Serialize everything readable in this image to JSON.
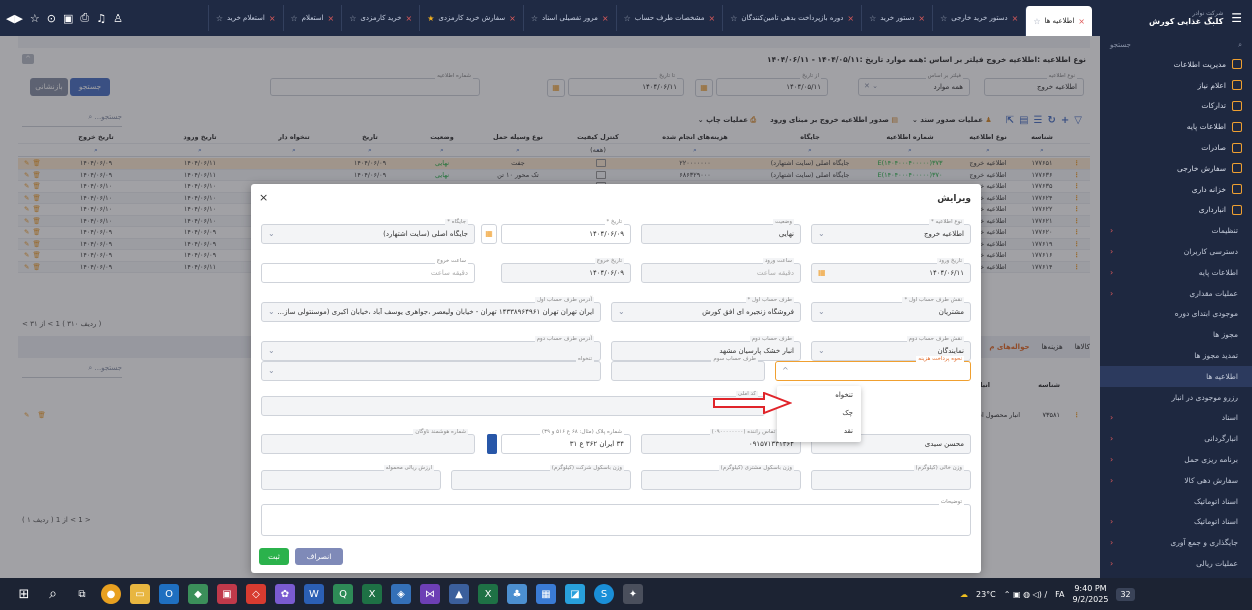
{
  "tabs": {
    "items": [
      {
        "label": "اطلاعیه ها",
        "active": true
      },
      {
        "label": "دستور خرید خارجی"
      },
      {
        "label": "دستور خرید"
      },
      {
        "label": "دوره بازپرداخت بدهی تامین‌کنندگان"
      },
      {
        "label": "مشخصات طرف حساب"
      },
      {
        "label": "مرور تفصیلی اسناد"
      },
      {
        "label": "سفارش خرید کارمزدی",
        "starred": true
      },
      {
        "label": "خرید کارمزدی"
      },
      {
        "label": "استعلام"
      },
      {
        "label": "استعلام خرید"
      }
    ]
  },
  "sidebar": {
    "company_small": "شرکت نوادر",
    "company": "کلبگ غذایی کورش",
    "search_placeholder": "جستجو",
    "items": [
      {
        "label": "مدیریت اطلاعات",
        "sub": false,
        "arrow": false,
        "active": false
      },
      {
        "label": "اعلام نیاز",
        "sub": false,
        "arrow": false,
        "active": false
      },
      {
        "label": "تدارکات",
        "sub": false,
        "arrow": false,
        "active": false
      },
      {
        "label": "اطلاعات پایه",
        "sub": false,
        "arrow": false,
        "active": false
      },
      {
        "label": "صادرات",
        "sub": false,
        "arrow": false,
        "active": false
      },
      {
        "label": "سفارش خارجی",
        "sub": false,
        "arrow": false,
        "active": false
      },
      {
        "label": "خزانه داری",
        "sub": false,
        "arrow": false,
        "active": false
      },
      {
        "label": "انبارداری",
        "sub": false,
        "arrow": false,
        "active": false
      },
      {
        "label": "تنظیمات",
        "sub": true,
        "arrow": true,
        "active": false
      },
      {
        "label": "دسترسی کاربران",
        "sub": true,
        "arrow": true,
        "active": false
      },
      {
        "label": "اطلاعات پایه",
        "sub": true,
        "arrow": true,
        "active": false
      },
      {
        "label": "عملیات مقداری",
        "sub": true,
        "arrow": true,
        "active": false
      },
      {
        "label": "موجودی ابتدای دوره",
        "sub": true,
        "arrow": false,
        "active": false
      },
      {
        "label": "مجوز ها",
        "sub": true,
        "arrow": false,
        "active": false
      },
      {
        "label": "تمدید مجوز ها",
        "sub": true,
        "arrow": false,
        "active": false
      },
      {
        "label": "اطلاعیه ها",
        "sub": true,
        "arrow": false,
        "active": true
      },
      {
        "label": "رزرو موجودی در انبار",
        "sub": true,
        "arrow": false,
        "active": false
      },
      {
        "label": "اسناد",
        "sub": true,
        "arrow": true,
        "active": false
      },
      {
        "label": "انبارگردانی",
        "sub": true,
        "arrow": true,
        "active": false
      },
      {
        "label": "برنامه ریزی حمل",
        "sub": true,
        "arrow": true,
        "active": false
      },
      {
        "label": "سفارش دهی کالا",
        "sub": true,
        "arrow": true,
        "active": false
      },
      {
        "label": "اسناد اتوماتیک",
        "sub": true,
        "arrow": false,
        "active": false
      },
      {
        "label": "اسناد اتوماتیک",
        "sub": true,
        "arrow": true,
        "active": false
      },
      {
        "label": "جایگذاری و جمع آوری",
        "sub": true,
        "arrow": true,
        "active": false
      },
      {
        "label": "عملیات ریالی",
        "sub": true,
        "arrow": true,
        "active": false
      },
      {
        "label": "گزارشات",
        "sub": true,
        "arrow": true,
        "active": false
      }
    ]
  },
  "page": {
    "title": "نوع اطلاعیه :اطلاعیه خروج  فیلتر بر اساس :همه موارد  تاریخ :۱۴۰۴/۰۵/۱۱ - ۱۴۰۴/۰۶/۱۱",
    "filter_notice_type_label": "نوع اطلاعیه",
    "filter_notice_type_value": "اطلاعیه خروج",
    "filter_based_on_label": "فیلتر بر اساس",
    "filter_based_on_value": "همه موارد",
    "filter_from_date_label": "از تاریخ",
    "filter_from_date_value": "۱۴۰۴/۰۵/۱۱",
    "filter_to_date_label": "تا تاریخ",
    "filter_to_date_value": "۱۴۰۴/۰۶/۱۱",
    "filter_notice_no_label": "شماره اطلاعیه",
    "search_button": "جستجو",
    "reset_button": "بازنشانی"
  },
  "toolbar": {
    "issue_ops": "عملیات صدور سند",
    "issue_exit_by_entry": "صدور اطلاعیه خروج بر مبنای ورود",
    "print_ops": "عملیات چاپ",
    "search_placeholder": "جستجو..."
  },
  "grid": {
    "headers": [
      "شناسه",
      "نوع اطلاعیه",
      "شماره اطلاعیه",
      "جایگاه",
      "هزینه‌های انجام شده",
      "کنترل کیفیت",
      "نوع وسیله حمل",
      "وضعیت",
      "تاریخ",
      "تنخواه دار",
      "تاریخ ورود",
      "تاریخ خروج"
    ],
    "filter_badge": "(همه)",
    "rows": [
      {
        "id": "۱۷۷۶۵۱",
        "type": "اطلاعیه خروج",
        "no": "E(۱۴۰۴۰۰۰۴۰۰۰۰۰)۳۷۳",
        "place": "جایگاه اصلی (سایت اشتهارد)",
        "cost": "۲۲۰۰۰۰۰۰۰",
        "vehicle": "جفت",
        "status": "نهایی",
        "date": "۱۴۰۴/۰۶/۰۹",
        "entry": "۱۴۰۴/۰۶/۱۱",
        "exit": "۱۴۰۴/۰۶/۰۹",
        "sel": true
      },
      {
        "id": "۱۷۷۶۳۶",
        "type": "اطلاعیه خروج",
        "no": "E(۱۴۰۴۰۰۰۴۰۰۰۰۰)۳۷۰",
        "place": "جایگاه اصلی (سایت اشتهارد)",
        "cost": "۶۸۶۳۲۹۰۰۰",
        "vehicle": "تک محور ۱۰ تن",
        "status": "نهایی",
        "date": "۱۴۰۴/۰۶/۰۹",
        "entry": "۱۴۰۴/۰۶/۱۱",
        "exit": "۱۴۰۴/۰۶/۰۹",
        "sel": false
      },
      {
        "id": "۱۷۷۶۳۵",
        "type": "اطلاعیه خروج",
        "no": "",
        "place": "",
        "cost": "",
        "vehicle": "",
        "status": "",
        "date": "",
        "entry": "۱۴۰۴/۰۶/۱۰",
        "exit": "۱۴۰۴/۰۶/۱۰",
        "sel": false
      },
      {
        "id": "۱۷۷۶۲۴",
        "type": "اطلاعیه خروج",
        "no": "",
        "place": "",
        "cost": "",
        "vehicle": "",
        "status": "",
        "date": "",
        "entry": "۱۴۰۴/۰۶/۱۰",
        "exit": "۱۴۰۴/۰۶/۱۰",
        "sel": false
      },
      {
        "id": "۱۷۷۶۲۲",
        "type": "اطلاعیه خروج",
        "no": "",
        "place": "",
        "cost": "",
        "vehicle": "",
        "status": "",
        "date": "",
        "entry": "۱۴۰۴/۰۶/۱۰",
        "exit": "۱۴۰۴/۰۶/۱۰",
        "sel": false
      },
      {
        "id": "۱۷۷۶۲۱",
        "type": "اطلاعیه خروج",
        "no": "",
        "place": "",
        "cost": "",
        "vehicle": "",
        "status": "",
        "date": "",
        "entry": "۱۴۰۴/۰۶/۱۰",
        "exit": "۱۴۰۴/۰۶/۱۰",
        "sel": false
      },
      {
        "id": "۱۷۷۶۲۰",
        "type": "اطلاعیه خروج",
        "no": "",
        "place": "",
        "cost": "",
        "vehicle": "",
        "status": "",
        "date": "",
        "entry": "۱۴۰۴/۰۶/۰۹",
        "exit": "۱۴۰۴/۰۶/۰۹",
        "sel": false
      },
      {
        "id": "۱۷۷۶۱۹",
        "type": "اطلاعیه خروج",
        "no": "",
        "place": "",
        "cost": "",
        "vehicle": "",
        "status": "",
        "date": "",
        "entry": "۱۴۰۴/۰۶/۰۹",
        "exit": "۱۴۰۴/۰۶/۰۹",
        "sel": false
      },
      {
        "id": "۱۷۷۶۱۶",
        "type": "اطلاعیه خروج",
        "no": "",
        "place": "",
        "cost": "",
        "vehicle": "",
        "status": "",
        "date": "",
        "entry": "۱۴۰۴/۰۶/۰۹",
        "exit": "۱۴۰۴/۰۶/۰۹",
        "sel": false
      },
      {
        "id": "۱۷۷۶۱۴",
        "type": "اطلاعیه خروج",
        "no": "",
        "place": "",
        "cost": "",
        "vehicle": "",
        "status": "",
        "date": "",
        "entry": "۱۴۰۴/۰۶/۱۱",
        "exit": "۱۴۰۴/۰۶/۰۹",
        "sel": false
      }
    ],
    "pager": "( ردیف ۳۱۰ )   1  >   از ۳۱  >"
  },
  "lower": {
    "tabs": [
      "کالاها",
      "هزینه‌ها",
      "حواله‌های م"
    ],
    "headers": [
      "شناسه",
      "انبار"
    ],
    "row": {
      "id": "۷۳۵۸۱",
      "store": "انبار محصول اشتهارد"
    },
    "pager": "( ۱ ردیف )   1  >   از 1  >",
    "search_placeholder": "جستجو..."
  },
  "modal": {
    "title": "ویرایش",
    "close": "×",
    "fields": {
      "notice_type": {
        "label": "نوع اطلاعیه *",
        "value": "اطلاعیه خروج"
      },
      "status": {
        "label": "وضعیت",
        "value": "نهایی"
      },
      "date": {
        "label": "تاریخ *",
        "value": "۱۴۰۴/۰۶/۰۹"
      },
      "place": {
        "label": "جایگاه *",
        "value": "جایگاه اصلی (سایت اشتهارد)"
      },
      "entry_date": {
        "label": "تاریخ ورود",
        "value": "۱۴۰۴/۰۶/۱۱"
      },
      "entry_time": {
        "label": "ساعت ورود",
        "value": "دقیقه            ساعت"
      },
      "exit_date": {
        "label": "تاریخ خروج",
        "value": "۱۴۰۴/۰۶/۰۹"
      },
      "exit_time": {
        "label": "ساعت خروج",
        "value": "دقیقه            ساعت"
      },
      "party1_role": {
        "label": "نقش طرف حساب اول *",
        "value": "مشتریان"
      },
      "party1": {
        "label": "طرف حساب اول *",
        "value": "فروشگاه زنجیره ای افق کورش"
      },
      "party1_addr": {
        "label": "آدرس طرف حساب اول",
        "value": "ایران تهران تهران ۱۴۳۳۸۹۶۴۹۶۱  تهران - خیابان ولیعصر ،جواهری یوسف آباد ،خیابان اکبری (موسنتولی ساز..."
      },
      "party2_role": {
        "label": "نقش طرف حساب دوم",
        "value": "نمایندگان"
      },
      "party2": {
        "label": "طرف حساب دوم",
        "value": "انبار خشک پارسیان مشهد"
      },
      "party2_addr": {
        "label": "آدرس طرف حساب دوم",
        "value": ""
      },
      "payment_method": {
        "label": "نحوه پرداخت هزینه",
        "value": ""
      },
      "party3": {
        "label": "طرف حساب سوم",
        "value": ""
      },
      "petty": {
        "label": "تنخواه",
        "value": ""
      },
      "postal": {
        "label": "کد املی",
        "value": ""
      },
      "driver_mobile": {
        "label": "شماره تماس راننده (۰۹۰۰۰۰۰۰۰۰)",
        "value": "۰۹۱۵۷۱۳۳۱۳۶۴"
      },
      "driver_name": {
        "label": "",
        "value": "محسن سیدی"
      },
      "plate": {
        "label": "شماره پلاک (مثال: ۶۸ ع ۵۱۶ و ۳۹)",
        "value": "۳۴   ایران   ۳۶۲    ع    ۳۱"
      },
      "smart_no": {
        "label": "شماره هوشمند ناوگان",
        "value": ""
      },
      "empty_w": {
        "label": "وزن خالی (کیلوگرم)",
        "value": ""
      },
      "cust_w": {
        "label": "وزن باسکول مشتری (کیلوگرم)",
        "value": ""
      },
      "company_w": {
        "label": "وزن باسکول شرکت (کیلوگرم)",
        "value": ""
      },
      "rial_cost": {
        "label": "ارزش ریالی محموله",
        "value": ""
      },
      "notes": {
        "label": "توضیحات",
        "value": ""
      }
    },
    "dropdown": [
      "تنخواه",
      "چک",
      "نقد"
    ],
    "ok": "ثبت",
    "cancel": "انصراف"
  },
  "taskbar": {
    "weather": "23°C",
    "lang": "FA",
    "time": "9:40 PM",
    "date": "9/2/2025",
    "notif": "32"
  }
}
